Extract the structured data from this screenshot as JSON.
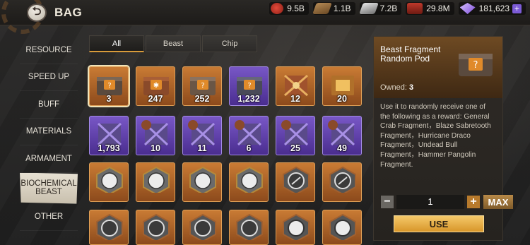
{
  "header": {
    "title": "BAG"
  },
  "resources": [
    {
      "icon": "meat-icon",
      "value": "9.5B"
    },
    {
      "icon": "wood-icon",
      "value": "1.1B"
    },
    {
      "icon": "steel-icon",
      "value": "7.2B"
    },
    {
      "icon": "cargo-icon",
      "value": "29.8M"
    },
    {
      "icon": "gem-icon",
      "value": "181,623"
    }
  ],
  "sidebar": {
    "items": [
      {
        "label": "RESOURCE"
      },
      {
        "label": "SPEED UP"
      },
      {
        "label": "BUFF"
      },
      {
        "label": "MATERIALS"
      },
      {
        "label": "ARMAMENT"
      },
      {
        "label": "BIOCHEMICAL BEAST",
        "active": true
      },
      {
        "label": "OTHER"
      }
    ]
  },
  "tabs": [
    {
      "label": "All",
      "active": true
    },
    {
      "label": "Beast"
    },
    {
      "label": "Chip"
    }
  ],
  "items_row1": [
    "3",
    "247",
    "252",
    "1,232",
    "12",
    "20"
  ],
  "items_row2": [
    "1,793",
    "10",
    "11",
    "6",
    "25",
    "49"
  ],
  "detail": {
    "title": "Beast Fragment Random Pod",
    "owned_label": "Owned:",
    "owned_value": "3",
    "description": "Use it to randomly receive one of the following as a reward: General Crab Fragment，Blaze Sabretooth Fragment，Hurricane Draco Fragment，Undead Bull Fragment，Hammer Pangolin Fragment."
  },
  "controls": {
    "minus": "−",
    "quantity": "1",
    "plus": "+",
    "max_label": "MAX",
    "use_label": "USE"
  },
  "colors": {
    "accent_orange": "#d8962a",
    "rarity_orange": "#c97b34",
    "rarity_purple": "#7857c6",
    "gem_plus": "#7c5bd6"
  }
}
